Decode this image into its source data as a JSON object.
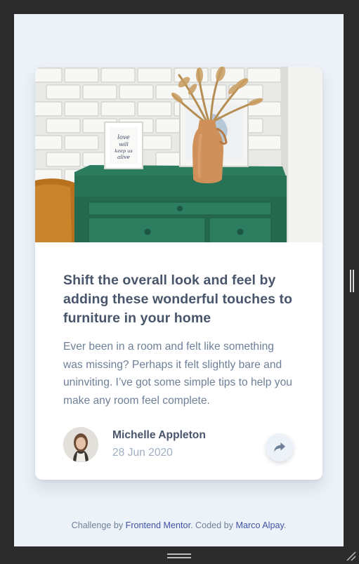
{
  "card": {
    "title": "Shift the overall look and feel by adding these wonderful touches to furniture in your home",
    "description": "Ever been in a room and felt like something was missing? Perhaps it felt slightly bare and uninviting. I’ve got some simple tips to help you make any room feel complete.",
    "author_name": "Michelle Appleton",
    "date": "28 Jun 2020",
    "frame_text_1": "love",
    "frame_text_2": "will",
    "frame_text_3": "keep us",
    "frame_text_4": "alive"
  },
  "icons": {
    "share": "share-icon"
  },
  "attribution": {
    "prefix": "Challenge by ",
    "link1": "Frontend Mentor",
    "middle": ". Coded by ",
    "link2": "Marco Alpay",
    "suffix": "."
  },
  "colors": {
    "background": "#ecf2f8",
    "heading": "#48556a",
    "body_text": "#6e8098",
    "date_text": "#9eafc2",
    "link": "#3e52a3",
    "drawer_green": "#2a7a5f",
    "frame_outer": "#2b2b2b"
  }
}
